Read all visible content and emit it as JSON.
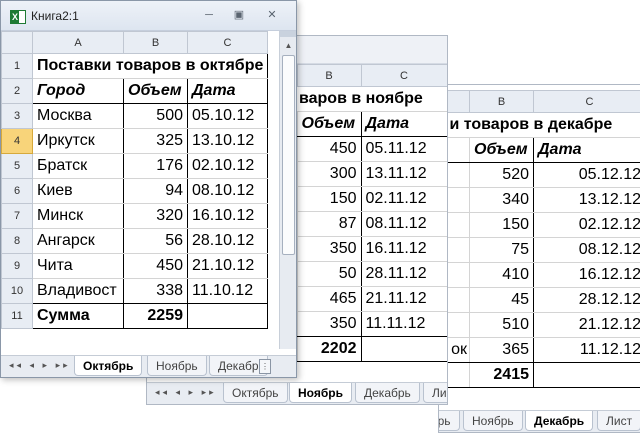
{
  "workbook": {
    "title": "Книга2:1"
  },
  "tab_nav_glyphs": "◂◂ ◂ ▸ ▸▸",
  "sheets": {
    "dec": {
      "cols": [
        "B",
        "C"
      ],
      "row_title": "и товаров в декабре",
      "headers": [
        "Объем",
        "Дата"
      ],
      "rows": [
        {
          "v": "520",
          "d": "05.12.12"
        },
        {
          "v": "340",
          "d": "13.12.12"
        },
        {
          "v": "150",
          "d": "02.12.12"
        },
        {
          "v": "75",
          "d": "08.12.12"
        },
        {
          "v": "410",
          "d": "16.12.12"
        },
        {
          "v": "45",
          "d": "28.12.12"
        },
        {
          "v": "510",
          "d": "21.12.12"
        },
        {
          "v": "365",
          "d": "11.12.12"
        }
      ],
      "row10_city_tail": "ок",
      "total": "2415",
      "tabs": [
        "Октябрь",
        "Ноябрь",
        "Декабрь",
        "Лист"
      ]
    },
    "nov": {
      "cols": [
        "B",
        "C"
      ],
      "row_title": "варов в ноябре",
      "headers": [
        "Объем",
        "Дата"
      ],
      "rows": [
        {
          "v": "450",
          "d": "05.11.12"
        },
        {
          "v": "300",
          "d": "13.11.12"
        },
        {
          "v": "150",
          "d": "02.11.12"
        },
        {
          "v": "87",
          "d": "08.11.12"
        },
        {
          "v": "350",
          "d": "16.11.12"
        },
        {
          "v": "50",
          "d": "28.11.12"
        },
        {
          "v": "465",
          "d": "21.11.12"
        },
        {
          "v": "350",
          "d": "11.11.12"
        }
      ],
      "total": "2202",
      "tabs": [
        "Октябрь",
        "Ноябрь",
        "Декабрь",
        "Ли"
      ]
    },
    "oct": {
      "cols": [
        "A",
        "B",
        "C"
      ],
      "row_numbers": [
        "1",
        "2",
        "3",
        "4",
        "5",
        "6",
        "7",
        "8",
        "9",
        "10",
        "11"
      ],
      "title": "Поставки товаров в октябре",
      "headers": [
        "Город",
        "Объем",
        "Дата"
      ],
      "rows": [
        {
          "city": "Москва",
          "v": "500",
          "d": "05.10.12"
        },
        {
          "city": "Иркутск",
          "v": "325",
          "d": "13.10.12"
        },
        {
          "city": "Братск",
          "v": "176",
          "d": "02.10.12"
        },
        {
          "city": "Киев",
          "v": "94",
          "d": "08.10.12"
        },
        {
          "city": "Минск",
          "v": "320",
          "d": "16.10.12"
        },
        {
          "city": "Ангарск",
          "v": "56",
          "d": "28.10.12"
        },
        {
          "city": "Чита",
          "v": "450",
          "d": "21.10.12"
        },
        {
          "city": "Владивост",
          "v": "338",
          "d": "11.10.12"
        }
      ],
      "total_label": "Сумма",
      "total": "2259",
      "tabs": [
        "Октябрь",
        "Ноябрь",
        "Декабр"
      ]
    }
  }
}
